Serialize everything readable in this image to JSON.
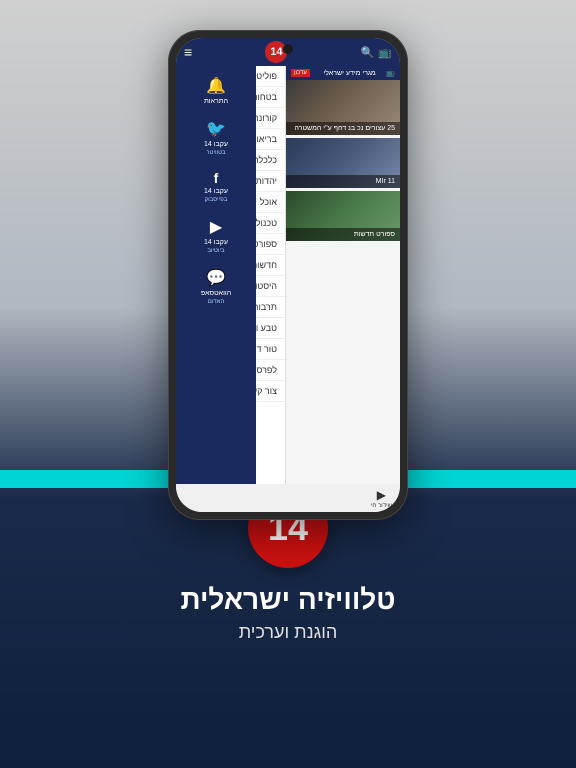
{
  "app": {
    "logo_number": "14",
    "header": {
      "menu_icon": "≡"
    }
  },
  "sidebar": {
    "items": [
      {
        "label": "פוליטי מדיני"
      },
      {
        "label": "בטחוני"
      },
      {
        "label": "קורונה"
      },
      {
        "label": "בריאות"
      },
      {
        "label": "כלכלה"
      },
      {
        "label": "יהדות"
      },
      {
        "label": "אוכל"
      },
      {
        "label": "טכנולוגיה"
      },
      {
        "label": "ספורט"
      },
      {
        "label": "חדשות חוץ"
      },
      {
        "label": "היסטוריה וציונות"
      },
      {
        "label": "תרבות"
      },
      {
        "label": "טבע וסביבה"
      },
      {
        "label": "טור דעה"
      },
      {
        "label": "לפרסום"
      },
      {
        "label": "צור קשר"
      }
    ]
  },
  "notifications": {
    "items": [
      {
        "icon": "🔔",
        "label": "התראות",
        "sub": ""
      },
      {
        "icon": "🐦",
        "label": "עקבו 14",
        "sub": "בטוויטר"
      },
      {
        "icon": "f",
        "label": "עקבו 14",
        "sub": "בפייסבוק"
      },
      {
        "icon": "▶",
        "label": "עקבו 14",
        "sub": "ביוטיוב"
      },
      {
        "icon": "💬",
        "label": "הוואטסאפ",
        "sub": "האדום"
      }
    ]
  },
  "news": {
    "ticker_label": "עדכון",
    "ticker_text": "מגרי מידע ישראלי",
    "ticker_icon": "📺",
    "items": [
      {
        "title": "25 עצורים נכ בנ דחף ע\"י המשטרה",
        "type": "soldiers"
      },
      {
        "title": "MIr 11",
        "type": "politician"
      },
      {
        "title": "ספורט חדשות",
        "type": "sports"
      }
    ]
  },
  "live_button": {
    "icon": "▶",
    "label": "שידור חי"
  },
  "bottom": {
    "tagline_main": "טלוויזיה ישראלית",
    "tagline_sub": "הוגנת וערכית",
    "logo_number": "14"
  }
}
